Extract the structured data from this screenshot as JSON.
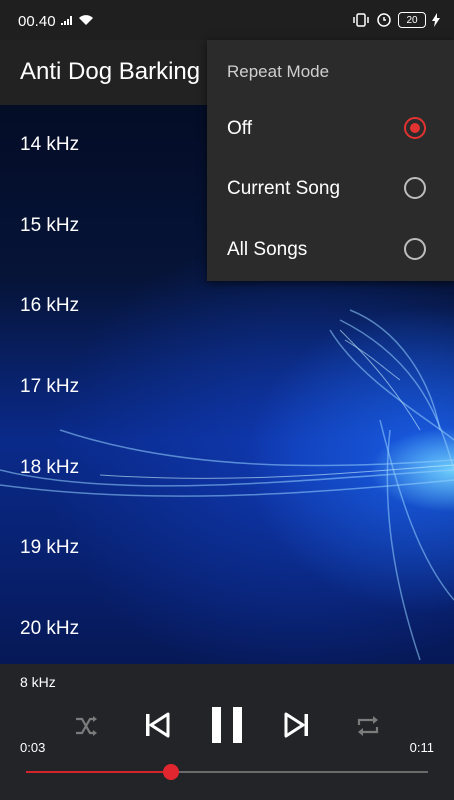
{
  "status_bar": {
    "time": "00.40",
    "battery": "20"
  },
  "app_bar": {
    "title": "Anti Dog Barking"
  },
  "frequencies": [
    "14 kHz",
    "15 kHz",
    "16 kHz",
    "17 kHz",
    "18 kHz",
    "19 kHz",
    "20 kHz"
  ],
  "repeat_menu": {
    "title": "Repeat Mode",
    "options": [
      {
        "label": "Off",
        "selected": true
      },
      {
        "label": "Current Song",
        "selected": false
      },
      {
        "label": "All Songs",
        "selected": false
      }
    ]
  },
  "player": {
    "now_playing": "8 kHz",
    "elapsed": "0:03",
    "total": "0:11",
    "progress": 0.36,
    "icons": [
      "shuffle-icon",
      "previous-icon",
      "pause-icon",
      "next-icon",
      "repeat-icon"
    ]
  },
  "colors": {
    "accent": "#e1262f",
    "panel": "#232428",
    "appbar": "#222222"
  }
}
